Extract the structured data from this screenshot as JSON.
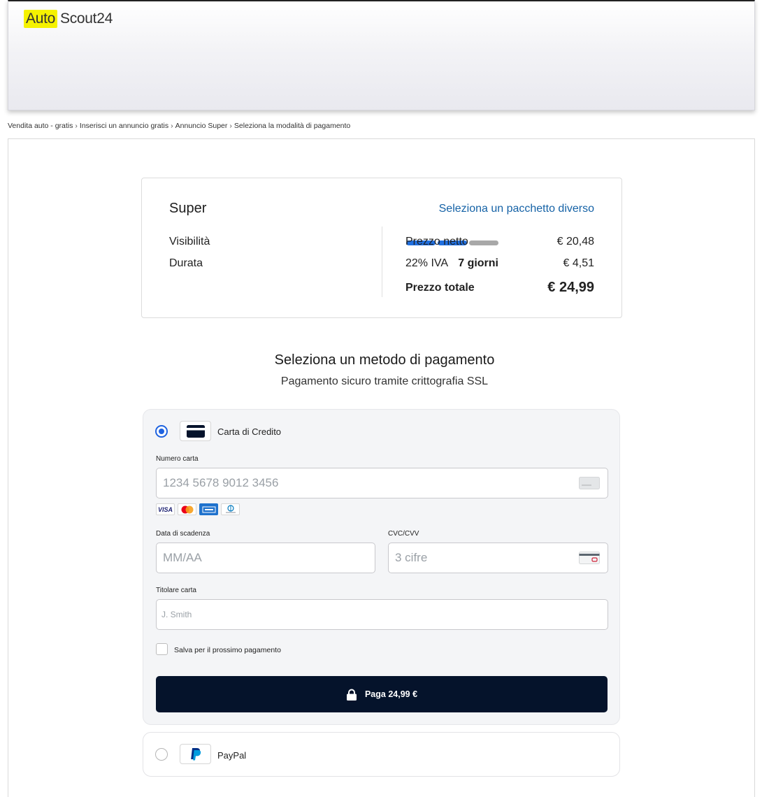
{
  "header": {
    "logo_auto": "Auto",
    "logo_scout": "Scout24",
    "logo_color": "#f5f200"
  },
  "breadcrumb": [
    "Vendita auto - gratis",
    "Inserisci un annuncio gratis",
    "Annuncio Super",
    "Seleziona la modalità di pagamento"
  ],
  "breadcrumb_sep": "›",
  "package": {
    "name": "Super",
    "change_link": "Seleziona un pacchetto diverso",
    "visibility_label": "Visibilità",
    "visibility_level": 2,
    "visibility_max": 3,
    "duration_label": "Durata",
    "duration_value": "7 giorni",
    "net_label": "Prezzo netto",
    "net_value": "€ 20,48",
    "vat_label": "22% IVA",
    "vat_value": "€ 4,51",
    "total_label": "Prezzo totale",
    "total_value": "€ 24,99",
    "link_color": "#1562a6",
    "bar_active_color": "#1f6fe0",
    "bar_inactive_color": "#a8a8a8"
  },
  "payment": {
    "title": "Seleziona un metodo di pagamento",
    "subtitle": "Pagamento sicuro tramite crittografia SSL",
    "credit_card": {
      "label": "Carta di Credito",
      "selected": true,
      "icon": "credit-card-icon",
      "card_number_label": "Numero carta",
      "card_number_placeholder": "1234 5678 9012 3456",
      "card_brands": [
        "VISA",
        "mastercard",
        "amex",
        "diners"
      ],
      "expiry_label": "Data di scadenza",
      "expiry_placeholder": "MM/AA",
      "cvc_label": "CVC/CVV",
      "cvc_placeholder": "3 cifre",
      "holder_label": "Titolare carta",
      "holder_placeholder": "J. Smith",
      "save_label": "Salva per il prossimo pagamento",
      "save_checked": false,
      "pay_button": "Paga 24,99 €",
      "pay_button_color": "#05132b",
      "radio_color": "#1f63e0"
    },
    "paypal": {
      "label": "PayPal",
      "selected": false,
      "icon": "paypal-icon"
    }
  }
}
